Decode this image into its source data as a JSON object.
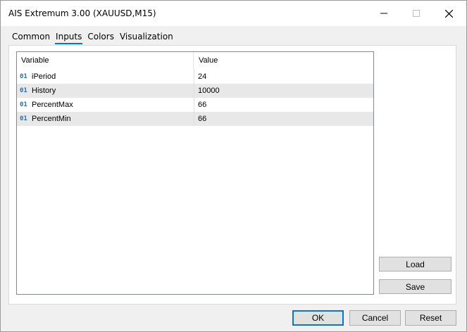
{
  "window": {
    "title": "AIS Extremum 3.00 (XAUUSD,M15)",
    "minimize_icon": "minimize-icon",
    "maximize_icon": "maximize-icon",
    "close_icon": "close-icon"
  },
  "tabs": [
    {
      "label": "Common",
      "active": false
    },
    {
      "label": "Inputs",
      "active": true
    },
    {
      "label": "Colors",
      "active": false
    },
    {
      "label": "Visualization",
      "active": false
    }
  ],
  "grid": {
    "columns": {
      "variable": "Variable",
      "value": "Value"
    },
    "rows": [
      {
        "icon_text": "01",
        "variable": "iPeriod",
        "value": "24"
      },
      {
        "icon_text": "01",
        "variable": "History",
        "value": "10000"
      },
      {
        "icon_text": "01",
        "variable": "PercentMax",
        "value": "66"
      },
      {
        "icon_text": "01",
        "variable": "PercentMin",
        "value": "66"
      }
    ]
  },
  "side_buttons": {
    "load": "Load",
    "save": "Save"
  },
  "footer_buttons": {
    "ok": "OK",
    "cancel": "Cancel",
    "reset": "Reset"
  },
  "colors": {
    "accent": "#0078d7",
    "row_alt": "#e8e8e8",
    "icon": "#2c6fb3"
  }
}
